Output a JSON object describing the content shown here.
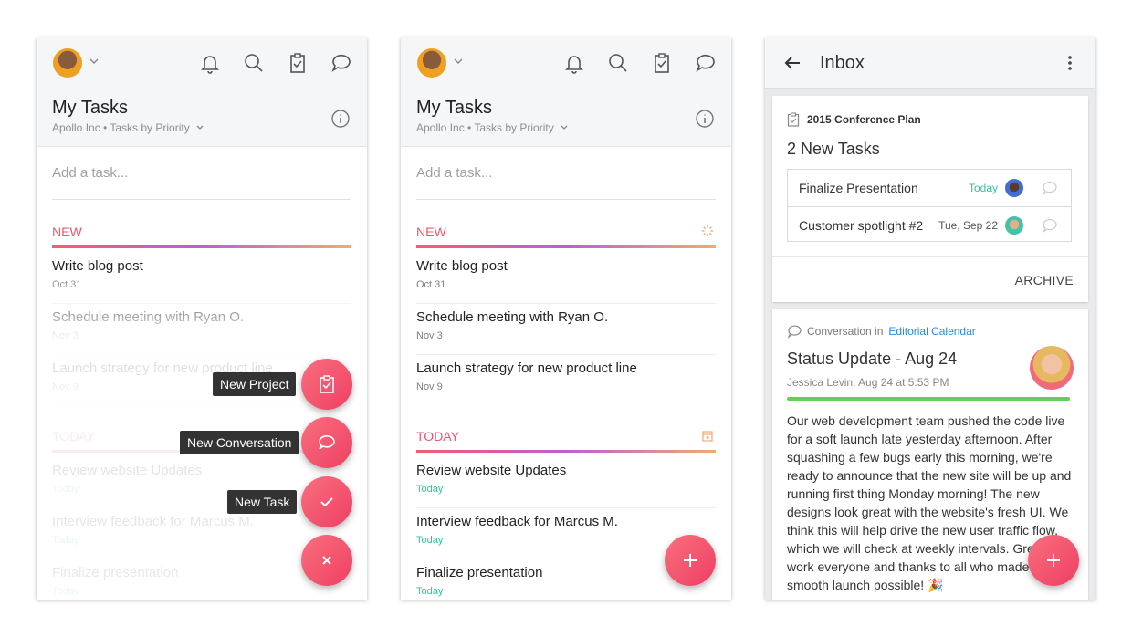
{
  "tasks_view": {
    "title": "My Tasks",
    "subtitle": "Apollo Inc • Tasks by Priority",
    "add_placeholder": "Add a task...",
    "sections": [
      {
        "label": "NEW",
        "tasks": [
          {
            "name": "Write blog post",
            "date": "Oct 31"
          },
          {
            "name": "Schedule meeting with Ryan O.",
            "date": "Nov 3"
          },
          {
            "name": "Launch strategy for new product line",
            "date": "Nov 9"
          }
        ]
      },
      {
        "label": "TODAY",
        "tasks": [
          {
            "name": "Review website Updates",
            "date": "Today"
          },
          {
            "name": "Interview feedback for Marcus M.",
            "date": "Today"
          },
          {
            "name": "Finalize presentation",
            "date": "Today"
          }
        ]
      }
    ]
  },
  "fab_menu": {
    "new_project": "New Project",
    "new_conversation": "New Conversation",
    "new_task": "New Task"
  },
  "inbox": {
    "title": "Inbox",
    "card1": {
      "project": "2015 Conference Plan",
      "heading": "2 New Tasks",
      "rows": [
        {
          "name": "Finalize Presentation",
          "date": "Today"
        },
        {
          "name": "Customer spotlight #2",
          "date": "Tue, Sep 22"
        }
      ],
      "archive": "ARCHIVE"
    },
    "card2": {
      "conv_prefix": "Conversation in",
      "project_link": "Editorial Calendar",
      "title": "Status Update - Aug 24",
      "meta": "Jessica Levin, Aug 24 at 5:53 PM",
      "body": "Our web development team pushed the code live for a soft launch late yesterday afternoon. After squashing a few bugs early this morning, we're ready to announce that the new site will be up and running first thing Monday morning! The new designs look great with the website's fresh UI. We think this will help drive the new user traffic flow, which we will check at weekly intervals.  Great work everyone and thanks to all who made this smooth launch possible! 🎉"
    }
  },
  "colors": {
    "accent": "#f2556b",
    "today": "#30c5a0",
    "link": "#2c8ad7",
    "progress": "#62cf5b"
  }
}
